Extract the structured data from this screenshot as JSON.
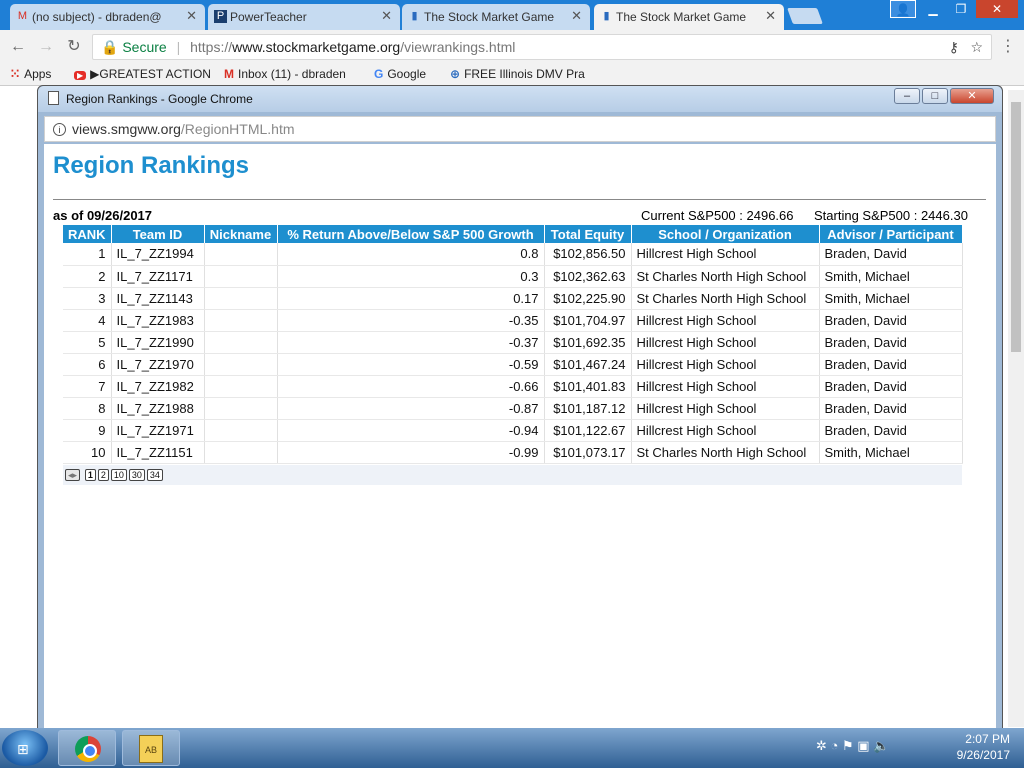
{
  "tabs": [
    {
      "title": "(no subject) - dbraden@",
      "icon": "gmail-icon",
      "active": false
    },
    {
      "title": "PowerTeacher",
      "icon": "powerteacher-icon",
      "active": false
    },
    {
      "title": "The Stock Market Game",
      "icon": "smg-icon",
      "active": false
    },
    {
      "title": "The Stock Market Game",
      "icon": "smg-icon",
      "active": true
    }
  ],
  "address_bar": {
    "secure_label": "Secure",
    "url_scheme": "https://",
    "url_host": "www.stockmarketgame.org",
    "url_path": "/viewrankings.html"
  },
  "bookmarks": [
    {
      "label": "Apps",
      "icon": "apps-grid-icon"
    },
    {
      "label": "▶GREATEST ACTION",
      "icon": "youtube-icon"
    },
    {
      "label": "Inbox (11) - dbraden",
      "icon": "gmail-icon"
    },
    {
      "label": "Google",
      "icon": "google-icon"
    },
    {
      "label": "FREE Illinois DMV Pra",
      "icon": "globe-icon"
    }
  ],
  "popup": {
    "window_title": "Region Rankings - Google Chrome",
    "url_host": "views.smgww.org",
    "url_path": "/RegionHTML.htm",
    "page_title": "Region Rankings",
    "as_of": "as of 09/26/2017",
    "current_sp": "Current S&P500 : 2496.66",
    "starting_sp": "Starting S&P500 : 2446.30",
    "columns": [
      "RANK",
      "Team ID",
      "Nickname",
      "% Return Above/Below S&P 500 Growth",
      "Total Equity",
      "School / Organization",
      "Advisor / Participant"
    ],
    "rows": [
      {
        "rank": "1",
        "team_id": "IL_7_ZZ1994",
        "nickname": "",
        "return": "0.8",
        "equity": "$102,856.50",
        "school": "Hillcrest High School",
        "advisor": "Braden, David"
      },
      {
        "rank": "2",
        "team_id": "IL_7_ZZ1171",
        "nickname": "",
        "return": "0.3",
        "equity": "$102,362.63",
        "school": "St Charles North High School",
        "advisor": "Smith, Michael"
      },
      {
        "rank": "3",
        "team_id": "IL_7_ZZ1143",
        "nickname": "",
        "return": "0.17",
        "equity": "$102,225.90",
        "school": "St Charles North High School",
        "advisor": "Smith, Michael"
      },
      {
        "rank": "4",
        "team_id": "IL_7_ZZ1983",
        "nickname": "",
        "return": "-0.35",
        "equity": "$101,704.97",
        "school": "Hillcrest High School",
        "advisor": "Braden, David"
      },
      {
        "rank": "5",
        "team_id": "IL_7_ZZ1990",
        "nickname": "",
        "return": "-0.37",
        "equity": "$101,692.35",
        "school": "Hillcrest High School",
        "advisor": "Braden, David"
      },
      {
        "rank": "6",
        "team_id": "IL_7_ZZ1970",
        "nickname": "",
        "return": "-0.59",
        "equity": "$101,467.24",
        "school": "Hillcrest High School",
        "advisor": "Braden, David"
      },
      {
        "rank": "7",
        "team_id": "IL_7_ZZ1982",
        "nickname": "",
        "return": "-0.66",
        "equity": "$101,401.83",
        "school": "Hillcrest High School",
        "advisor": "Braden, David"
      },
      {
        "rank": "8",
        "team_id": "IL_7_ZZ1988",
        "nickname": "",
        "return": "-0.87",
        "equity": "$101,187.12",
        "school": "Hillcrest High School",
        "advisor": "Braden, David"
      },
      {
        "rank": "9",
        "team_id": "IL_7_ZZ1971",
        "nickname": "",
        "return": "-0.94",
        "equity": "$101,122.67",
        "school": "Hillcrest High School",
        "advisor": "Braden, David"
      },
      {
        "rank": "10",
        "team_id": "IL_7_ZZ1151",
        "nickname": "",
        "return": "-0.99",
        "equity": "$101,073.17",
        "school": "St Charles North High School",
        "advisor": "Smith, Michael"
      }
    ],
    "pager": {
      "pages": [
        "1",
        "2",
        "10",
        "30",
        "34"
      ],
      "current": "1"
    }
  },
  "taskbar": {
    "clock_time": "2:07 PM",
    "clock_date": "9/26/2017"
  },
  "colors": {
    "accent": "#1e8fcf",
    "chrome_frame": "#1f7fd6",
    "secure_green": "#0b8043"
  }
}
